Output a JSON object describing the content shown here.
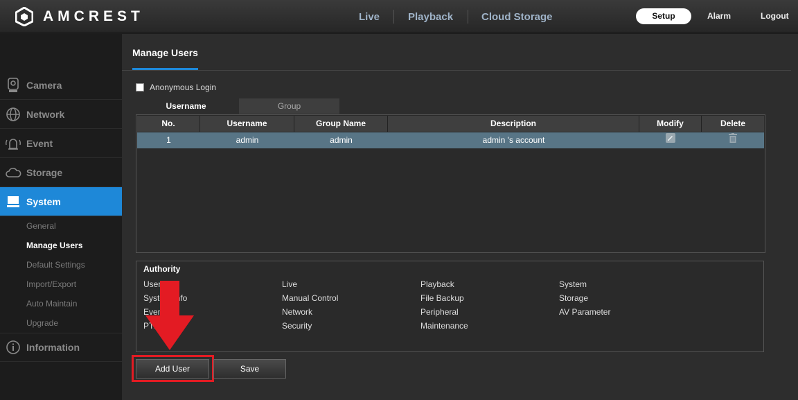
{
  "header": {
    "brand": "AMCREST",
    "nav": [
      "Live",
      "Playback",
      "Cloud Storage"
    ],
    "setup_label": "Setup",
    "alarm_label": "Alarm",
    "logout_label": "Logout"
  },
  "sidebar": {
    "items": [
      {
        "label": "Camera",
        "icon": "camera-icon"
      },
      {
        "label": "Network",
        "icon": "globe-icon"
      },
      {
        "label": "Event",
        "icon": "alarm-icon"
      },
      {
        "label": "Storage",
        "icon": "cloud-icon"
      },
      {
        "label": "System",
        "icon": "monitor-icon"
      },
      {
        "label": "Information",
        "icon": "info-icon"
      }
    ],
    "sub_items": [
      "General",
      "Manage Users",
      "Default Settings",
      "Import/Export",
      "Auto Maintain",
      "Upgrade"
    ]
  },
  "main": {
    "title": "Manage Users",
    "anonymous_label": "Anonymous Login",
    "tabs": [
      "Username",
      "Group"
    ],
    "table": {
      "headers": [
        "No.",
        "Username",
        "Group Name",
        "Description",
        "Modify",
        "Delete"
      ],
      "rows": [
        {
          "no": "1",
          "username": "admin",
          "group": "admin",
          "description": "admin 's account"
        }
      ]
    },
    "authority": {
      "title": "Authority",
      "items": [
        "User",
        "Live",
        "Playback",
        "System",
        "System Info",
        "Manual Control",
        "File Backup",
        "Storage",
        "Event",
        "Network",
        "Peripheral",
        "AV Parameter",
        "PTZ",
        "Security",
        "Maintenance"
      ]
    },
    "buttons": {
      "add_user": "Add User",
      "save": "Save"
    }
  },
  "colors": {
    "accent": "#1e88d8",
    "highlight": "#e31b23",
    "row_selected": "#587586"
  }
}
